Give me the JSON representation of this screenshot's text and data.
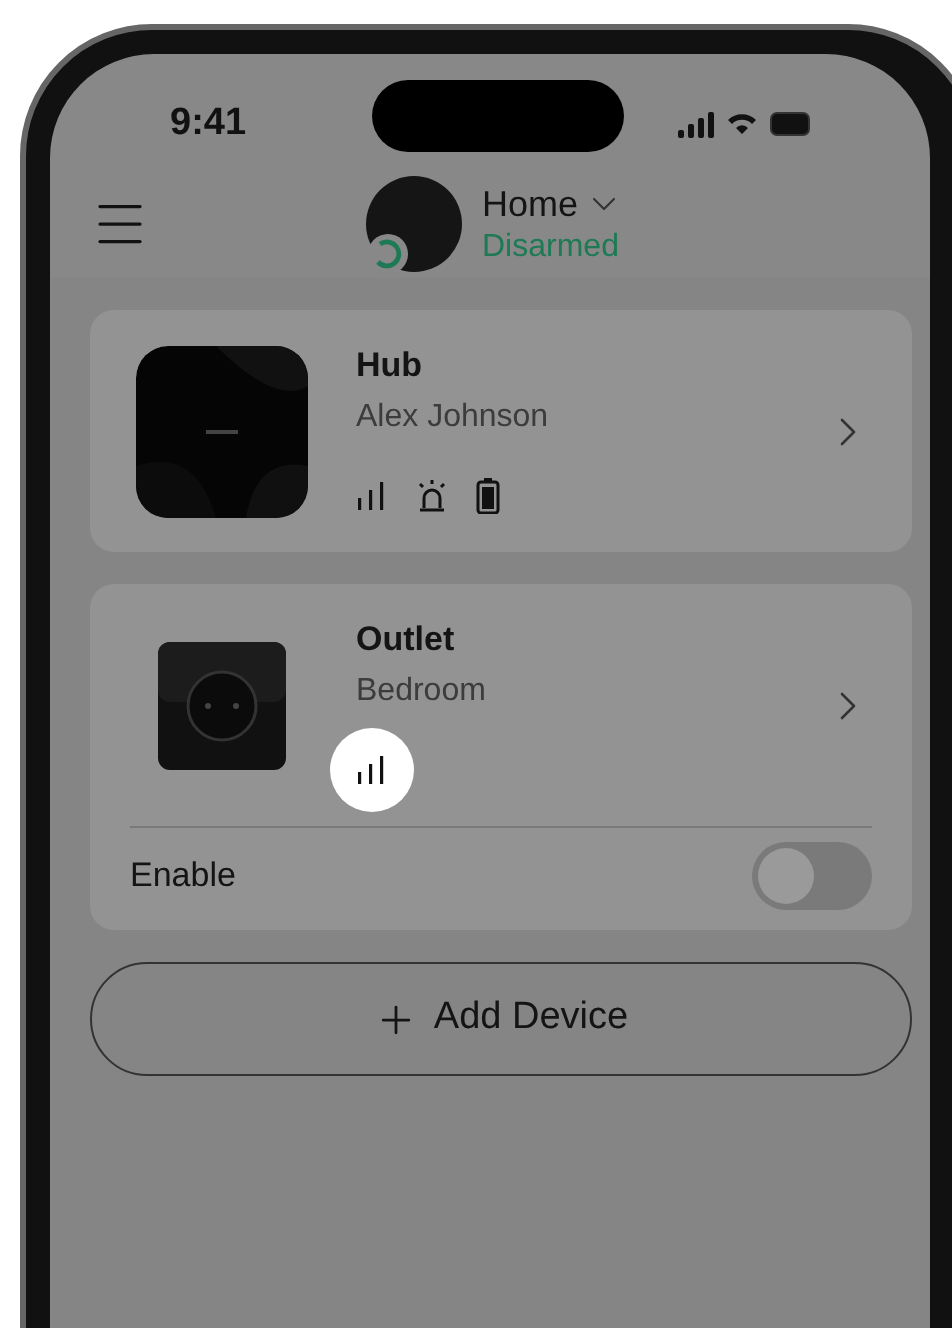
{
  "status_bar": {
    "time": "9:41"
  },
  "header": {
    "home_name": "Home",
    "status": "Disarmed"
  },
  "devices": [
    {
      "kind": "hub",
      "name": "Hub",
      "subtitle": "Alex Johnson",
      "indicators": [
        {
          "kind": "signal",
          "highlighted": false
        },
        {
          "kind": "siren",
          "highlighted": false
        },
        {
          "kind": "battery",
          "highlighted": false
        }
      ]
    },
    {
      "kind": "outlet",
      "name": "Outlet",
      "subtitle": "Bedroom",
      "indicators": [
        {
          "kind": "signal",
          "highlighted": true
        }
      ],
      "toggle": {
        "label": "Enable",
        "on": false
      }
    }
  ],
  "add_button": {
    "label": "Add Device"
  }
}
